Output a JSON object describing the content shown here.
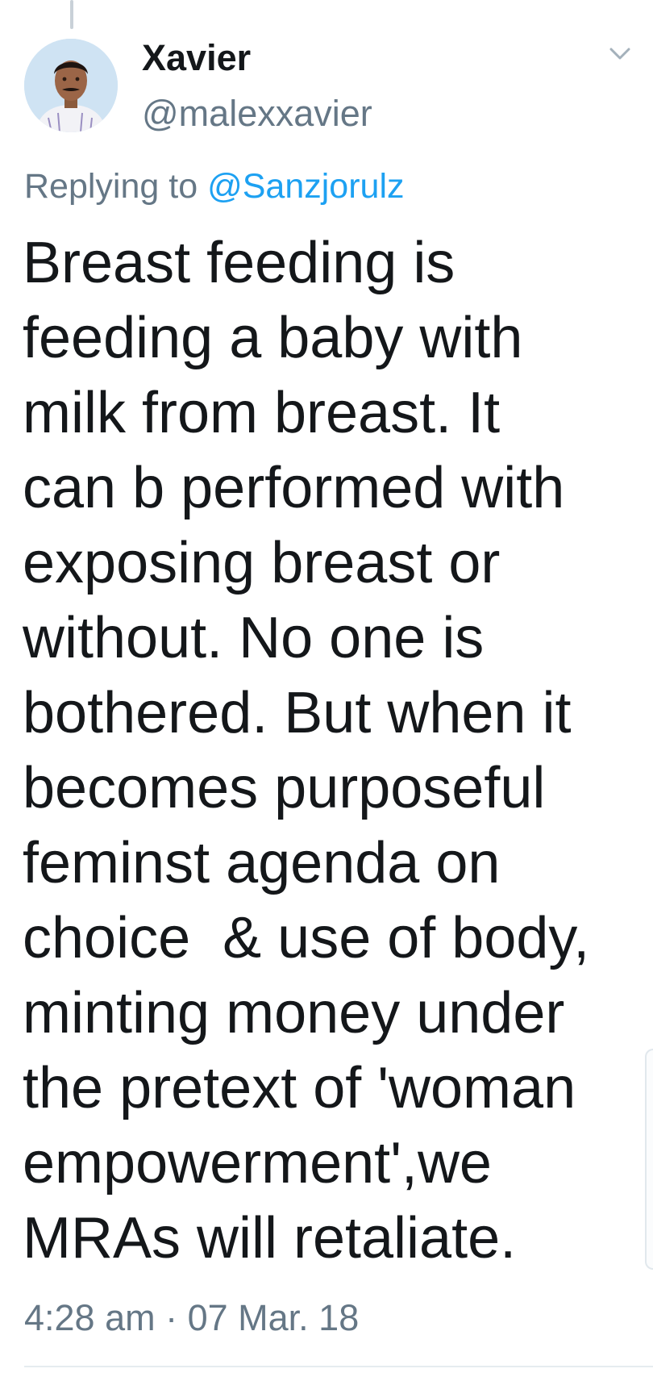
{
  "tweet": {
    "author_name": "Xavier",
    "author_handle": "@malexxavier",
    "reply_prefix": "Replying to ",
    "reply_mention": "@Sanzjorulz",
    "text": "Breast feeding is\nfeeding a baby with\nmilk from breast. It\ncan b performed with\nexposing breast or\nwithout. No one is\nbothered. But when it\nbecomes purposeful\nfeminst agenda on\nchoice  & use of body,\nminting money under\nthe pretext of 'woman\nempowerment',we\nMRAs will retaliate.",
    "timestamp": "4:28 am · 07 Mar. 18"
  },
  "icons": {
    "menu": "chevron-down-icon",
    "avatar": "avatar-photo"
  },
  "colors": {
    "primary_text": "#14171a",
    "secondary_text": "#657786",
    "link": "#1da1f2",
    "divider": "#e6ecf0",
    "thread_line": "#c9d1d8"
  }
}
